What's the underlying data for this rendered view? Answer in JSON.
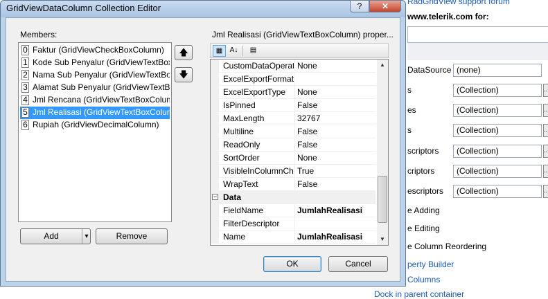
{
  "background": {
    "top_link": "RadGridView support forum",
    "url_text": "www.telerik.com for:",
    "rows": [
      {
        "label": "DataSource",
        "value": "(none)"
      },
      {
        "label": "s",
        "value": "(Collection)"
      },
      {
        "label": "es",
        "value": "(Collection)"
      },
      {
        "label": "s",
        "value": "(Collection)"
      },
      {
        "label": "scriptors",
        "value": "(Collection)"
      },
      {
        "label": "criptors",
        "value": "(Collection)"
      },
      {
        "label": "escriptors",
        "value": "(Collection)"
      }
    ],
    "options": [
      "e Adding",
      "e Editing",
      "e Column Reordering"
    ],
    "links": [
      "perty Builder",
      "Columns",
      "Dock in parent container"
    ],
    "ellipsis": "..."
  },
  "dialog": {
    "title": "GridViewDataColumn Collection Editor",
    "help_label": "?",
    "close_label": "✕",
    "members_label": "Members:",
    "members": [
      {
        "index": "0",
        "text": "Faktur (GridViewCheckBoxColumn)",
        "selected": false
      },
      {
        "index": "1",
        "text": "Kode Sub Penyalur (GridViewTextBoxColumn)",
        "selected": false
      },
      {
        "index": "2",
        "text": "Nama Sub Penyalur (GridViewTextBoxColumn)",
        "selected": false
      },
      {
        "index": "3",
        "text": "Alamat Sub Penyalur (GridViewTextBoxColumn)",
        "selected": false
      },
      {
        "index": "4",
        "text": "Jml Rencana (GridViewTextBoxColumn)",
        "selected": false
      },
      {
        "index": "5",
        "text": "Jml Realisasi (GridViewTextBoxColumn)",
        "selected": true
      },
      {
        "index": "6",
        "text": "Rupiah (GridViewDecimalColumn)",
        "selected": false
      }
    ],
    "move_up": "🡅",
    "move_down": "🡇",
    "add_label": "Add",
    "add_dropdown": "▾",
    "remove_label": "Remove",
    "properties_label": "Jml Realisasi (GridViewTextBoxColumn) proper...",
    "toolbar": {
      "categorized": "▦",
      "alphabetical": "A↓",
      "pages": "▤"
    },
    "properties": [
      {
        "name": "CustomDataOperation",
        "value": "None",
        "bold": false
      },
      {
        "name": "ExcelExportFormatString",
        "value": "",
        "bold": false
      },
      {
        "name": "ExcelExportType",
        "value": "None",
        "bold": false
      },
      {
        "name": "IsPinned",
        "value": "False",
        "bold": false
      },
      {
        "name": "MaxLength",
        "value": "32767",
        "bold": false
      },
      {
        "name": "Multiline",
        "value": "False",
        "bold": false
      },
      {
        "name": "ReadOnly",
        "value": "False",
        "bold": false
      },
      {
        "name": "SortOrder",
        "value": "None",
        "bold": false
      },
      {
        "name": "VisibleInColumnChooser",
        "value": "True",
        "bold": false
      },
      {
        "name": "WrapText",
        "value": "False",
        "bold": false
      }
    ],
    "category": {
      "toggle": "−",
      "name": "Data"
    },
    "data_properties": [
      {
        "name": "FieldName",
        "value": "JumlahRealisasi",
        "bold": true
      },
      {
        "name": "FilterDescriptor",
        "value": "",
        "bold": false
      },
      {
        "name": "Name",
        "value": "JumlahRealisasi",
        "bold": true
      }
    ],
    "scroll_up": "▲",
    "scroll_down": "▼",
    "ok_label": "OK",
    "cancel_label": "Cancel"
  }
}
